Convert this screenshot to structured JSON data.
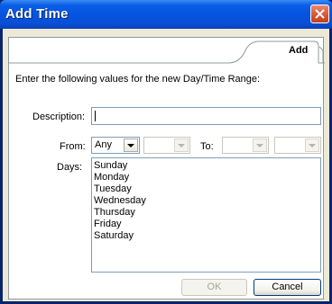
{
  "window": {
    "title": "Add Time"
  },
  "tab": {
    "label": "Add"
  },
  "instruction": "Enter the following values for the new Day/Time Range:",
  "fields": {
    "description_label": "Description:",
    "description_value": "",
    "from_label": "From:",
    "from_value": "Any",
    "to_label": "To:",
    "days_label": "Days:"
  },
  "days": [
    "Sunday",
    "Monday",
    "Tuesday",
    "Wednesday",
    "Thursday",
    "Friday",
    "Saturday"
  ],
  "buttons": {
    "ok": "OK",
    "cancel": "Cancel"
  }
}
